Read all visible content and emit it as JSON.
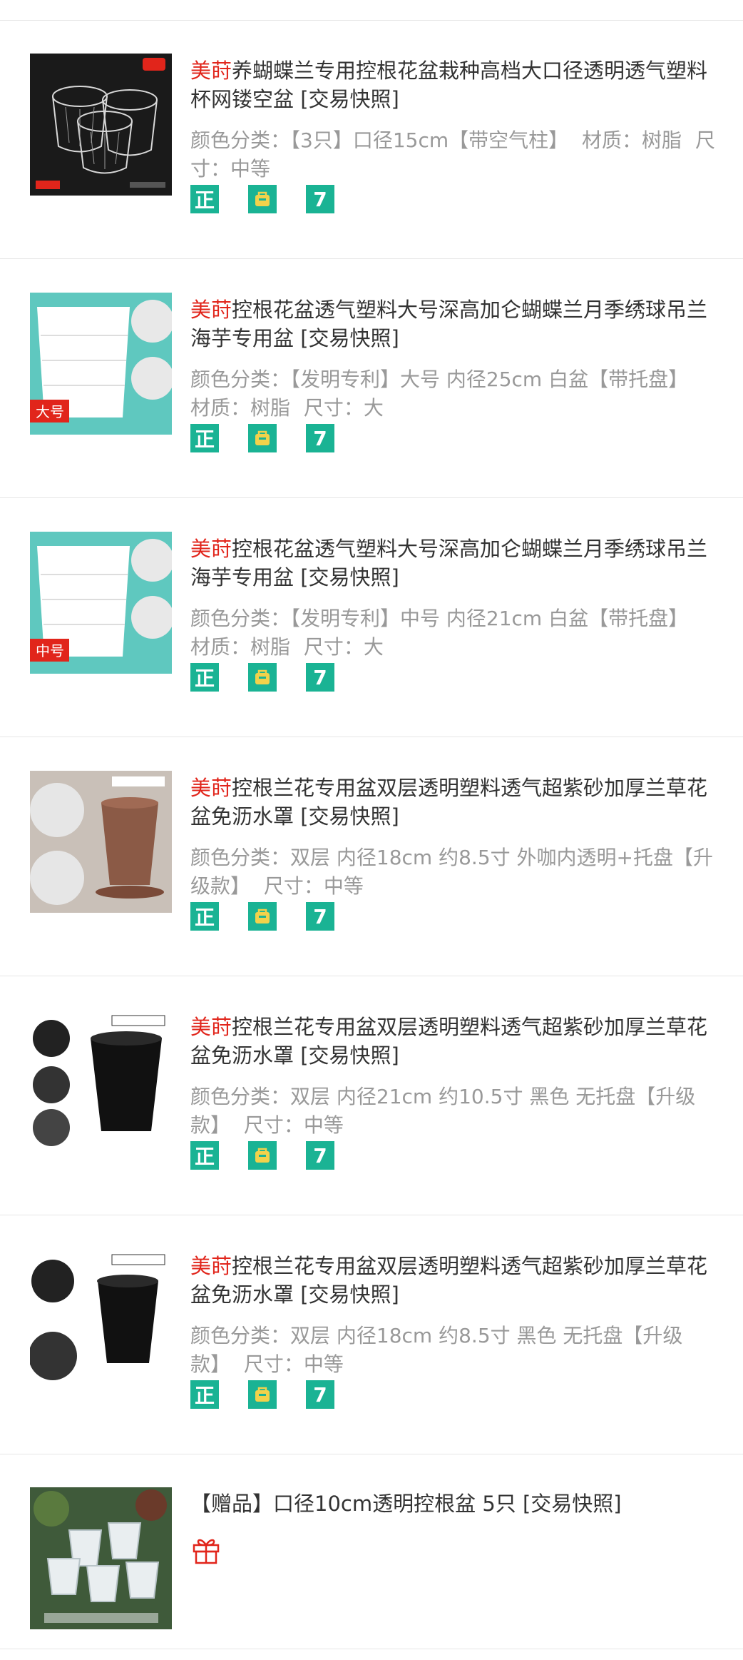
{
  "items": [
    {
      "brand": "美莳",
      "title": "养蝴蝶兰专用控根花盆栽种高档大口径透明透气塑料杯网镂空盆 [交易快照]",
      "sku": [
        "颜色分类：【3只】口径15cm【带空气柱】",
        "材质：树脂",
        "尺寸：中等"
      ],
      "image_alt": "透明镂空花盆"
    },
    {
      "brand": "美莳",
      "title": "控根花盆透气塑料大号深高加仑蝴蝶兰月季绣球吊兰海芋专用盆 [交易快照]",
      "sku": [
        "颜色分类：【发明专利】大号 内径25cm 白盆【带托盘】",
        "材质：树脂",
        "尺寸：大"
      ],
      "image_label": "大号"
    },
    {
      "brand": "美莳",
      "title": "控根花盆透气塑料大号深高加仑蝴蝶兰月季绣球吊兰海芋专用盆 [交易快照]",
      "sku": [
        "颜色分类：【发明专利】中号 内径21cm 白盆【带托盘】",
        "材质：树脂",
        "尺寸：大"
      ],
      "image_label": "中号"
    },
    {
      "brand": "美莳",
      "title": "控根兰花专用盆双层透明塑料透气超紫砂加厚兰草花盆免沥水罩 [交易快照]",
      "sku": [
        "颜色分类：双层 内径18cm 约8.5寸 外咖内透明+托盘【升级款】",
        "尺寸：中等"
      ]
    },
    {
      "brand": "美莳",
      "title": "控根兰花专用盆双层透明塑料透气超紫砂加厚兰草花盆免沥水罩 [交易快照]",
      "sku": [
        "颜色分类：双层 内径21cm 约10.5寸 黑色 无托盘【升级款】",
        "尺寸：中等"
      ]
    },
    {
      "brand": "美莳",
      "title": "控根兰花专用盆双层透明塑料透气超紫砂加厚兰草花盆免沥水罩 [交易快照]",
      "sku": [
        "颜色分类：双层 内径18cm 约8.5寸 黑色 无托盘【升级款】",
        "尺寸：中等"
      ]
    }
  ],
  "badges": {
    "authentic": "正",
    "icon_names": [
      "authentic-badge-icon",
      "shopping-bag-badge-icon",
      "seven-day-return-badge-icon"
    ],
    "seven": "7",
    "color": "#1ab394"
  },
  "gift": {
    "title": "【赠品】口径10cm透明控根盆 5只 [交易快照]",
    "icon": "gift-icon"
  },
  "colors": {
    "brand": "#e1251b",
    "text": "#333333",
    "muted": "#999999",
    "divider": "#e6e6e6"
  }
}
